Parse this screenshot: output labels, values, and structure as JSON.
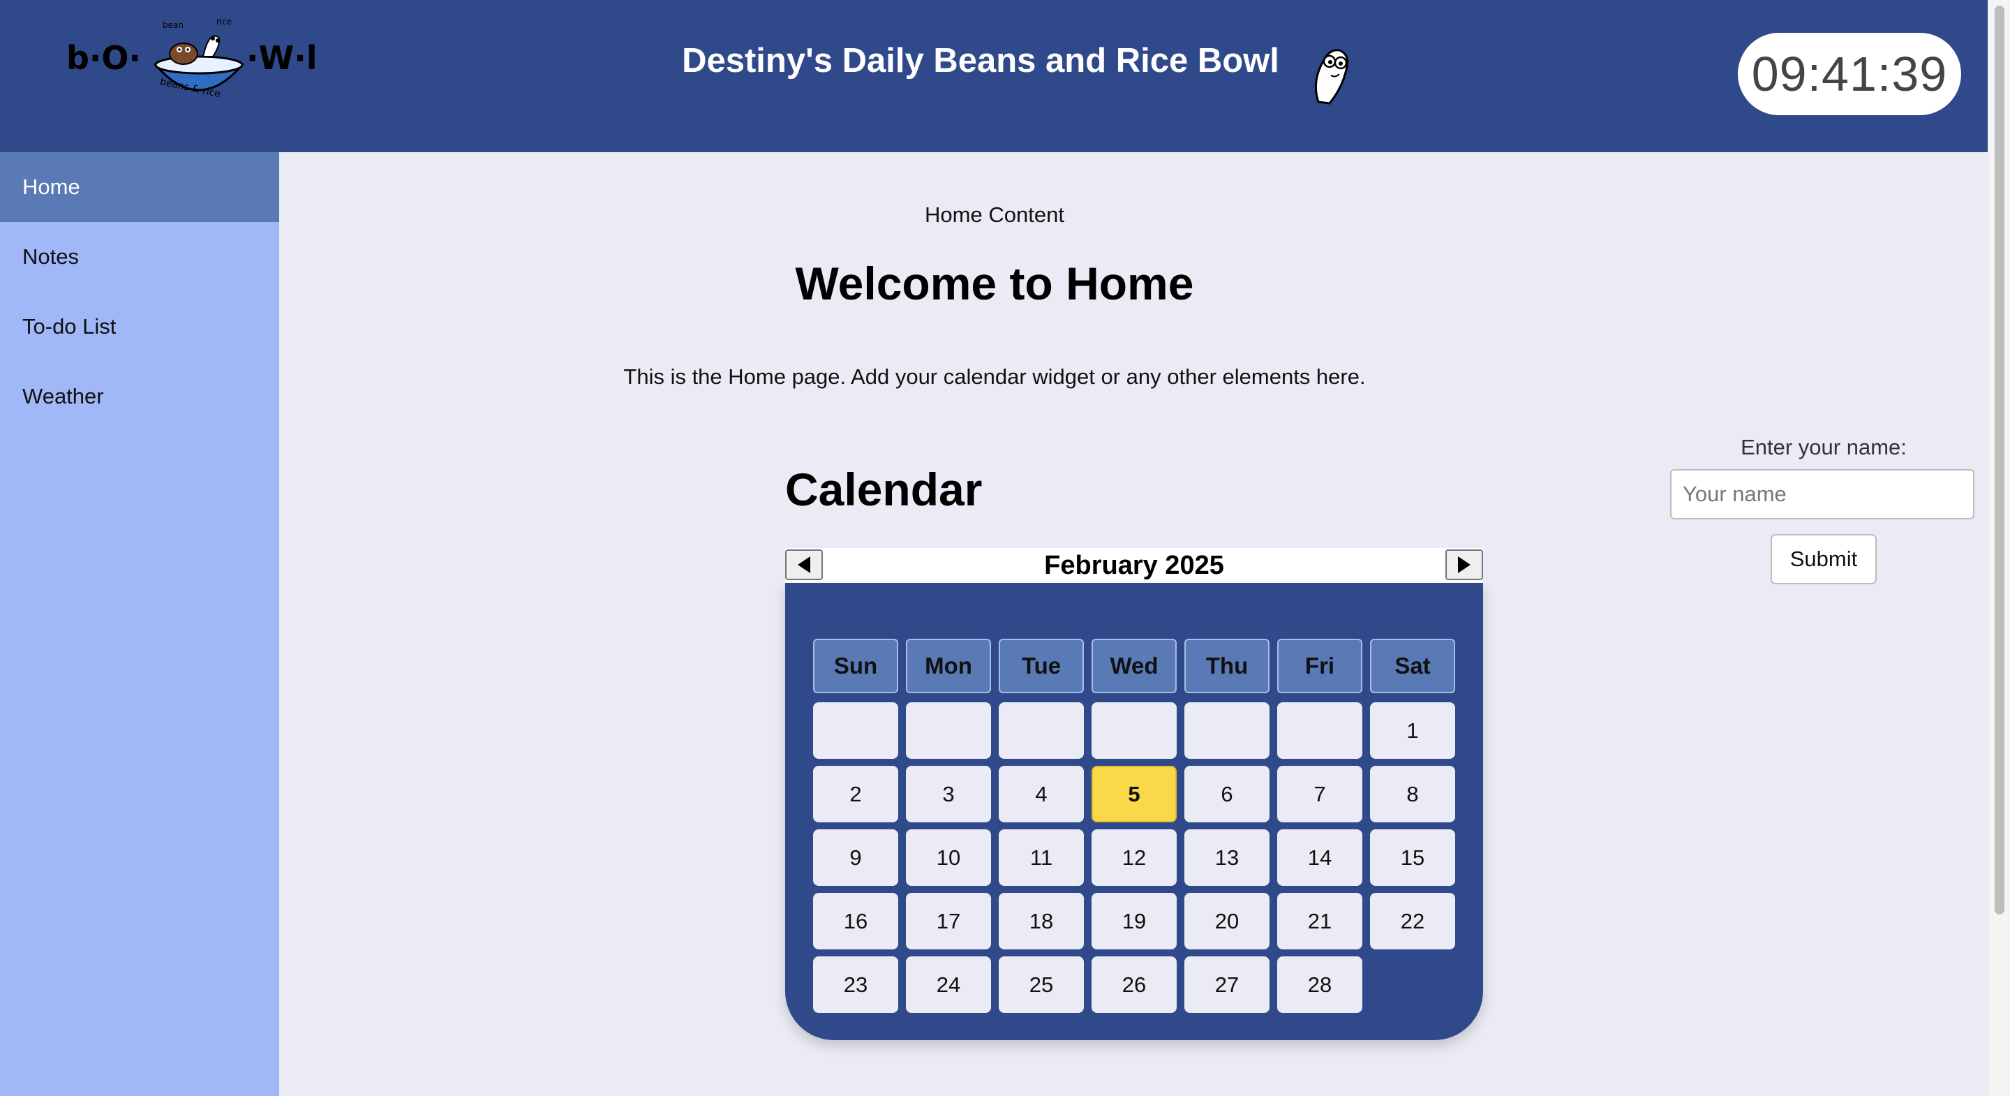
{
  "header": {
    "logo_text": "b·O·W·L",
    "logo_tags": [
      "bean",
      "rice",
      "beans & rice"
    ],
    "title": "Destiny's Daily Beans and Rice Bowl",
    "clock": "09:41:39"
  },
  "sidebar": {
    "items": [
      {
        "label": "Home",
        "active": true
      },
      {
        "label": "Notes",
        "active": false
      },
      {
        "label": "To-do List",
        "active": false
      },
      {
        "label": "Weather",
        "active": false
      }
    ]
  },
  "main": {
    "section_label": "Home Content",
    "heading": "Welcome to Home",
    "intro": "This is the Home page. Add your calendar widget or any other elements here."
  },
  "calendar": {
    "heading": "Calendar",
    "month_label": "February 2025",
    "weekdays": [
      "Sun",
      "Mon",
      "Tue",
      "Wed",
      "Thu",
      "Fri",
      "Sat"
    ],
    "leading_blanks": 6,
    "days_in_month": 28,
    "today": 5,
    "colors": {
      "body": "#30498b",
      "weekday_cell": "#5a7ab5",
      "day_cell": "#ebebf5",
      "today": "#f9d94a"
    }
  },
  "name_form": {
    "label": "Enter your name:",
    "placeholder": "Your name",
    "value": "",
    "submit_label": "Submit"
  },
  "colors": {
    "header_bg": "#30498b",
    "sidebar_bg": "#a0b8f8",
    "sidebar_active": "#5a7ab5",
    "page_bg": "#ebebf5"
  }
}
